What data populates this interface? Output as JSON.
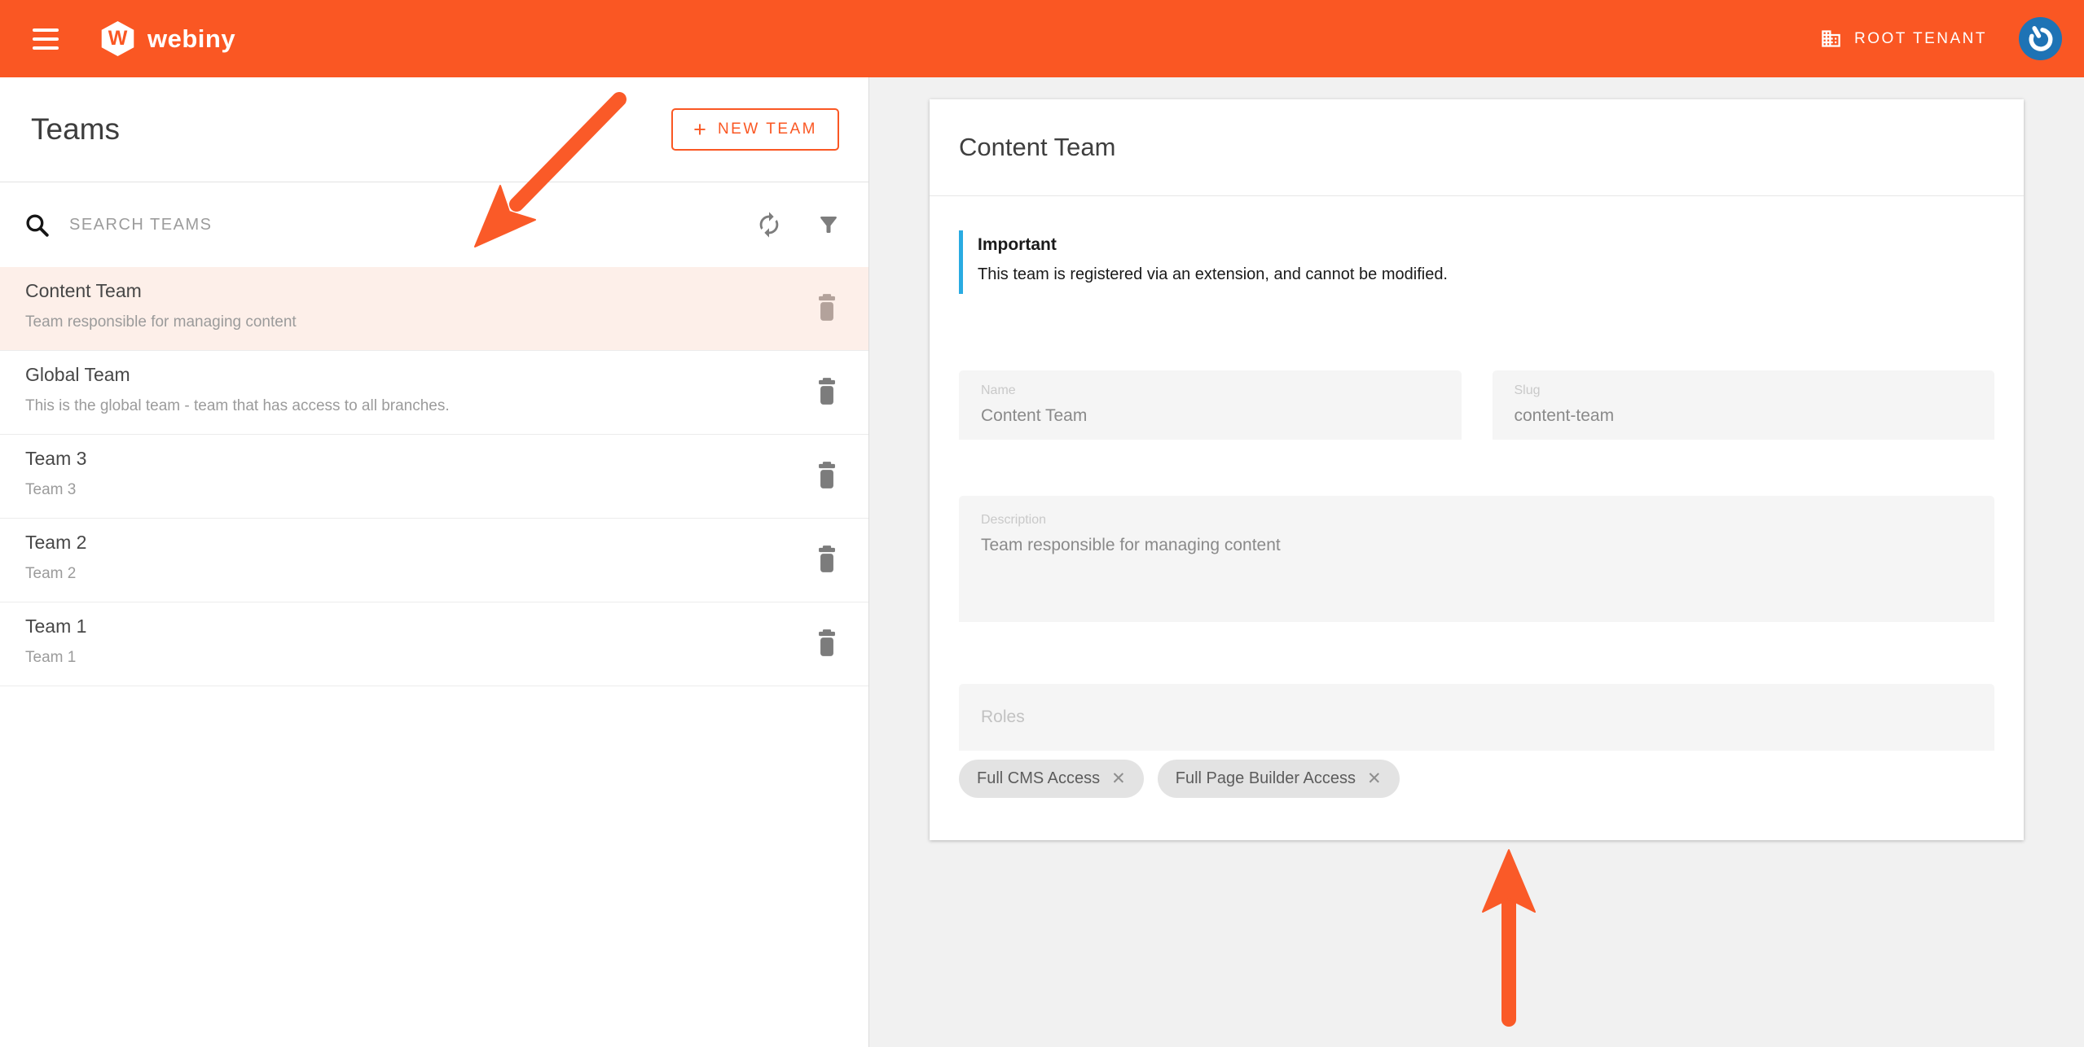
{
  "colors": {
    "brand_orange": "#fa5723",
    "notice_blue": "#29abe2",
    "avatar_blue": "#1e73b5",
    "selected_row_bg": "#fdefe9"
  },
  "header": {
    "brand": "webiny",
    "brand_initial": "W",
    "tenant_label": "ROOT TENANT"
  },
  "teams_panel": {
    "title": "Teams",
    "new_team_button": {
      "icon": "+",
      "label": "NEW TEAM"
    },
    "search_placeholder": "SEARCH TEAMS",
    "teams": [
      {
        "name": "Content Team",
        "description": "Team responsible for managing content",
        "selected": true
      },
      {
        "name": "Global Team",
        "description": "This is the global team - team that has access to all branches.",
        "selected": false
      },
      {
        "name": "Team 3",
        "description": "Team 3",
        "selected": false
      },
      {
        "name": "Team 2",
        "description": "Team 2",
        "selected": false
      },
      {
        "name": "Team 1",
        "description": "Team 1",
        "selected": false
      }
    ]
  },
  "details_panel": {
    "title": "Content Team",
    "notice": {
      "title": "Important",
      "message": "This team is registered via an extension, and cannot be modified."
    },
    "fields": {
      "name": {
        "label": "Name",
        "value": "Content Team"
      },
      "slug": {
        "label": "Slug",
        "value": "content-team"
      },
      "description": {
        "label": "Description",
        "value": "Team responsible for managing content"
      },
      "roles": {
        "label": "Roles"
      }
    },
    "role_chips": [
      {
        "label": "Full CMS Access"
      },
      {
        "label": "Full Page Builder Access"
      }
    ]
  },
  "icons": {
    "chip_remove": "✕"
  }
}
